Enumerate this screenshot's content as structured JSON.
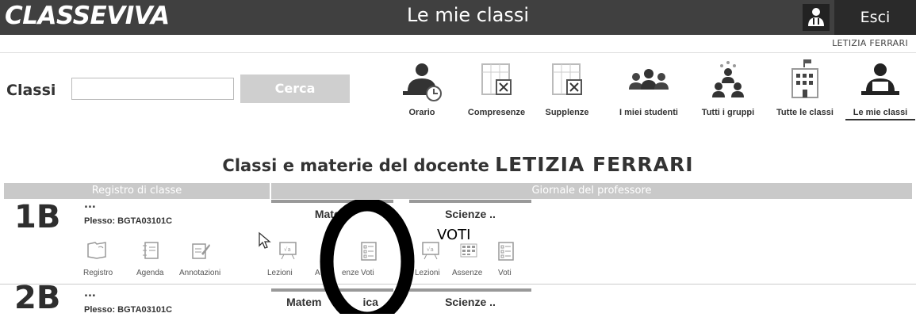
{
  "header": {
    "logo": "CLASSEVIVA",
    "title": "Le mie classi",
    "logout_label": "Esci",
    "username": "LETIZIA FERRARI"
  },
  "search": {
    "label": "Classi",
    "value": "",
    "button_label": "Cerca"
  },
  "nav": [
    {
      "label": "Orario",
      "icon": "teacher-clock-icon"
    },
    {
      "label": "Compresenze",
      "icon": "calendar-x-icon"
    },
    {
      "label": "Supplenze",
      "icon": "calendar-x-icon"
    },
    {
      "label": "I miei studenti",
      "icon": "students-icon"
    },
    {
      "label": "Tutti i gruppi",
      "icon": "groups-icon"
    },
    {
      "label": "Tutte le classi",
      "icon": "school-building-icon"
    },
    {
      "label": "Le mie classi",
      "icon": "teacher-icon",
      "active": true
    }
  ],
  "page": {
    "title_prefix": "Classi e materie del docente",
    "teacher": "LETIZIA FERRARI",
    "band_left": "Registro di classe",
    "band_right": "Giornale del professore"
  },
  "classes": [
    {
      "name": "1B",
      "dots": "...",
      "plesso": "Plesso: BGTA03101C",
      "actions": [
        "Registro",
        "Agenda",
        "Annotazioni"
      ],
      "subjects": [
        {
          "name": "Matem",
          "actions": [
            "Lezioni",
            "Assenze",
            "Voti"
          ]
        },
        {
          "name": "Scienze ..",
          "actions": [
            "Lezioni",
            "Assenze",
            "Voti"
          ]
        }
      ]
    },
    {
      "name": "2B",
      "dots": "...",
      "plesso": "Plesso: BGTA03101C",
      "subjects": [
        {
          "name": "Matem",
          "tail": "ica"
        },
        {
          "name": "Scienze .."
        }
      ]
    }
  ],
  "annotation": {
    "text": "VOTI",
    "visible_lezioni": "Lezioni",
    "visible_assenze_left": "A",
    "visible_assenze_right": "enze"
  },
  "colors": {
    "topbar": "#404040",
    "band": "#c9c9c9",
    "subject_bar": "#999999"
  }
}
